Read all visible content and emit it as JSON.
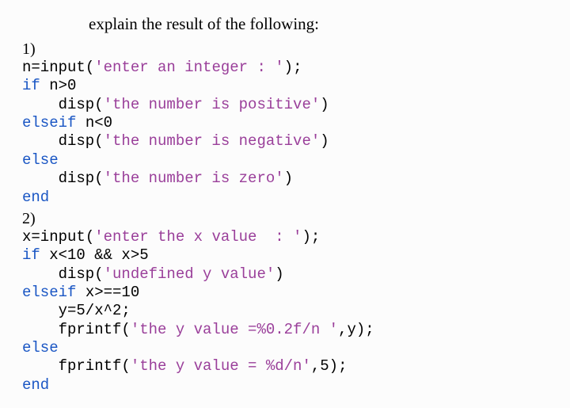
{
  "heading": "explain the result of the following:",
  "q1": {
    "num": "1)",
    "l1a": "n=input(",
    "l1b": "'enter an integer : '",
    "l1c": ");",
    "l2a": "if",
    "l2b": " n>0",
    "l3a": "disp(",
    "l3b": "'the number is positive'",
    "l3c": ")",
    "l4a": "elseif",
    "l4b": " n<0",
    "l5a": "disp(",
    "l5b": "'the number is negative'",
    "l5c": ")",
    "l6": "else",
    "l7a": "disp(",
    "l7b": "'the number is zero'",
    "l7c": ")",
    "l8": "end"
  },
  "q2": {
    "num": "2)",
    "l1a": "x=input(",
    "l1b": "'enter the x value  : '",
    "l1c": ");",
    "l2a": "if",
    "l2b": " x<10 && x>5",
    "l3a": "disp(",
    "l3b": "'undefined y value'",
    "l3c": ")",
    "l4a": "elseif",
    "l4b": " x>==10",
    "l5": "y=5/x^2;",
    "l6a": "fprintf(",
    "l6b": "'the y value =%0.2f/n '",
    "l6c": ",y);",
    "l7": "else",
    "l8a": "fprintf(",
    "l8b": "'the y value = %d/n'",
    "l8c": ",5);",
    "l9": "end"
  }
}
